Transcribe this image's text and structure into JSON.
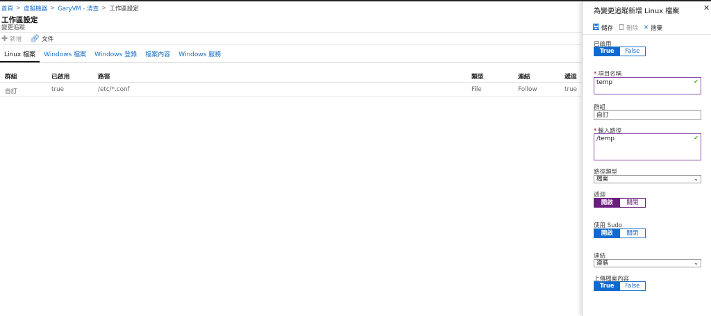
{
  "breadcrumb": [
    {
      "label": "首頁",
      "link": true
    },
    {
      "label": "虛擬機器",
      "link": true
    },
    {
      "label": "GaryVM - 清查",
      "link": true
    },
    {
      "label": "工作區設定",
      "link": false
    }
  ],
  "breadcrumb_separator": ">",
  "page": {
    "title": "工作區設定",
    "subtitle": "變更追蹤"
  },
  "toolbar": {
    "add": {
      "icon": "plus-icon",
      "label": "新增"
    },
    "docs": {
      "icon": "link-icon",
      "label": "文件"
    }
  },
  "tabs": [
    "Linux 檔案",
    "Windows 檔案",
    "Windows 登錄",
    "檔案內容",
    "Windows 服務"
  ],
  "active_tab": "Linux 檔案",
  "table": {
    "headers": [
      "群組",
      "已啟用",
      "路徑",
      "類型",
      "連結",
      "遞迴"
    ],
    "rows": [
      [
        "自訂",
        "true",
        "/etc/*.conf",
        "File",
        "Follow",
        "true"
      ]
    ]
  },
  "blade": {
    "title": "為變更追蹤新增 Linux 檔案",
    "close_icon": "close-icon",
    "save_label": "儲存",
    "delete_label": "刪除",
    "discard_label": "捨棄",
    "enabled": {
      "label": "已啟用",
      "on": "True",
      "off": "False",
      "value": "True"
    },
    "item_name": {
      "label": "項目名稱",
      "value": "temp"
    },
    "group": {
      "label": "群組",
      "value": "自訂"
    },
    "path": {
      "label": "輸入路徑",
      "value": "/temp"
    },
    "path_type": {
      "label": "路徑類型",
      "value": "檔案"
    },
    "recursion": {
      "label": "遞迴",
      "on": "開啟",
      "off": "關閉",
      "value": "開啟"
    },
    "use_sudo": {
      "label": "使用 Sudo",
      "on": "開啟",
      "off": "關閉",
      "value": "開啟"
    },
    "links": {
      "label": "連結",
      "value": "遵循"
    },
    "upload_content": {
      "label": "上傳檔案內容",
      "on": "True",
      "off": "False",
      "value": "True"
    }
  },
  "colors": {
    "accent": "#0e69d0",
    "purple": "#6b1f7d",
    "link": "#1a6fc7",
    "check": "#5aa02c"
  }
}
